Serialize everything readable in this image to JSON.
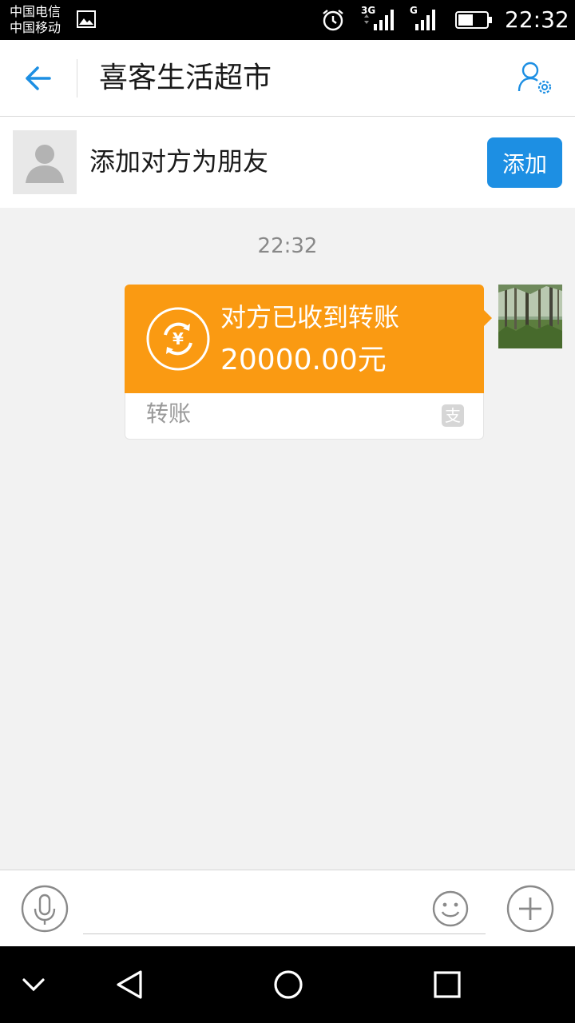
{
  "status_bar": {
    "carrier_1": "中国电信",
    "carrier_2": "中国移动",
    "network_1": "3G",
    "network_2": "G",
    "time": "22:32",
    "icons": [
      "gallery-icon",
      "alarm-icon",
      "signal-icon",
      "battery-icon"
    ]
  },
  "header": {
    "title": "喜客生活超市",
    "back_icon": "arrow-left-icon",
    "settings_icon": "profile-settings-icon",
    "accent_color": "#1d8fe3"
  },
  "add_friend": {
    "prompt": "添加对方为朋友",
    "button_label": "添加"
  },
  "chat": {
    "timestamp": "22:32",
    "transfer": {
      "status": "对方已收到转账",
      "amount": "20000.00元",
      "label": "转账",
      "brand_glyph": "支",
      "card_color": "#fa9a12"
    }
  },
  "input_bar": {
    "placeholder": "",
    "icons": [
      "microphone-icon",
      "emoji-icon",
      "plus-icon"
    ]
  },
  "nav_bar": {
    "icons": [
      "chevron-down-icon",
      "back-triangle-icon",
      "home-circle-icon",
      "recents-square-icon"
    ]
  }
}
